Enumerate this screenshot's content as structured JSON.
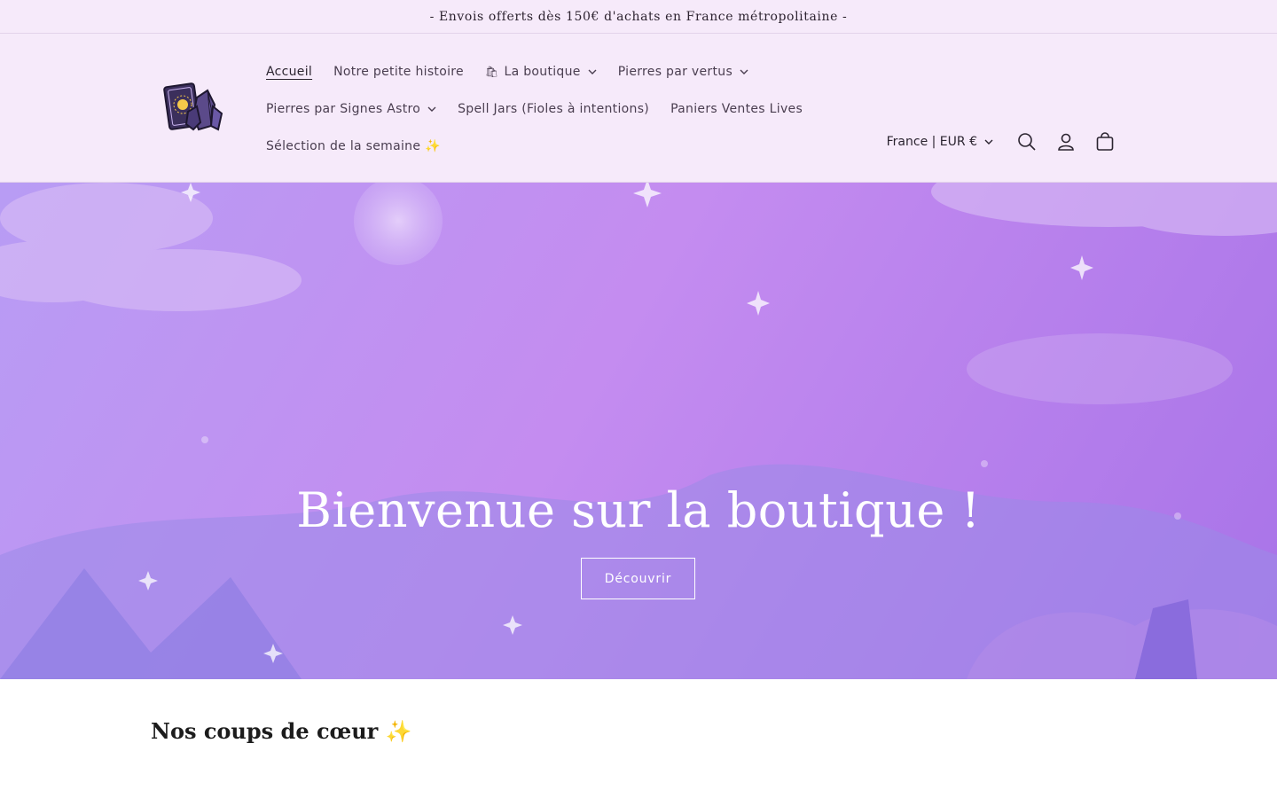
{
  "announcement": {
    "text": "- Envois offerts dès 150€ d'achats en France métropolitaine -"
  },
  "header": {
    "logo_icon": "tarot-crystal-logo-icon",
    "nav": [
      {
        "label": "Accueil",
        "active": true,
        "dropdown": false
      },
      {
        "label": "Notre petite histoire",
        "dropdown": false
      },
      {
        "label": "La boutique",
        "dropdown": true,
        "prefix_icon": "shopping-bag-icon",
        "prefix": "🛍"
      },
      {
        "label": "Pierres par vertus",
        "dropdown": true
      },
      {
        "label": "Pierres par Signes Astro",
        "dropdown": true
      },
      {
        "label": "Spell Jars (Fioles à intentions)",
        "dropdown": false
      },
      {
        "label": "Paniers Ventes Lives",
        "dropdown": false
      },
      {
        "label": "Sélection de la semaine ✨",
        "dropdown": false
      }
    ],
    "country_selector": "France | EUR €",
    "icons": [
      "search-icon",
      "account-icon",
      "cart-icon"
    ]
  },
  "hero": {
    "title": "Bienvenue sur la boutique !",
    "button_label": "Découvrir"
  },
  "featured": {
    "title": "Nos coups de cœur ✨"
  },
  "colors": {
    "header_bg": "#f6eafa",
    "hero_start": "#b89cf4",
    "hero_end": "#a873e8",
    "text": "#2b2430"
  }
}
